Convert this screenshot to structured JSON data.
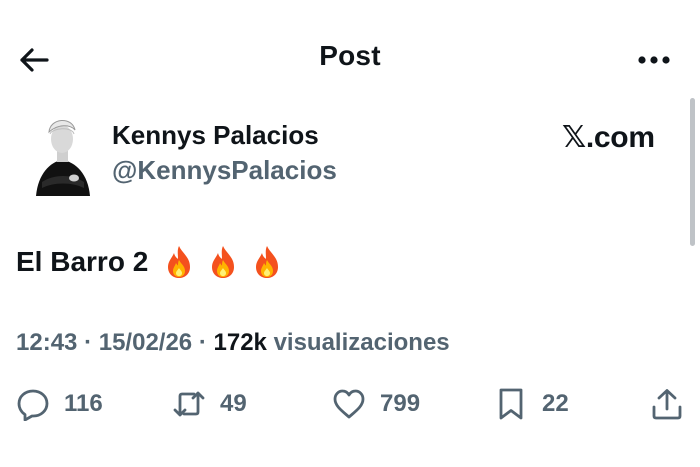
{
  "header": {
    "title": "Post"
  },
  "author": {
    "name": "Kennys Palacios",
    "handle": "@KennysPalacios"
  },
  "brand": "𝕏.com",
  "post": {
    "text": "El Barro 2",
    "emoji": [
      "🔥",
      "🔥",
      "🔥"
    ]
  },
  "meta": {
    "time": "12:43",
    "date": "15/02/26",
    "views": "172k",
    "views_label": "visualizaciones",
    "separator": "·"
  },
  "actions": {
    "replies": "116",
    "reposts": "49",
    "likes": "799",
    "bookmarks": "22"
  },
  "icons": [
    "back-arrow-icon",
    "more-icon",
    "reply-icon",
    "repost-icon",
    "heart-icon",
    "bookmark-icon",
    "share-icon",
    "fire-icon"
  ],
  "colors": {
    "text": "#0f1419",
    "secondary": "#536471",
    "background": "#ffffff"
  }
}
